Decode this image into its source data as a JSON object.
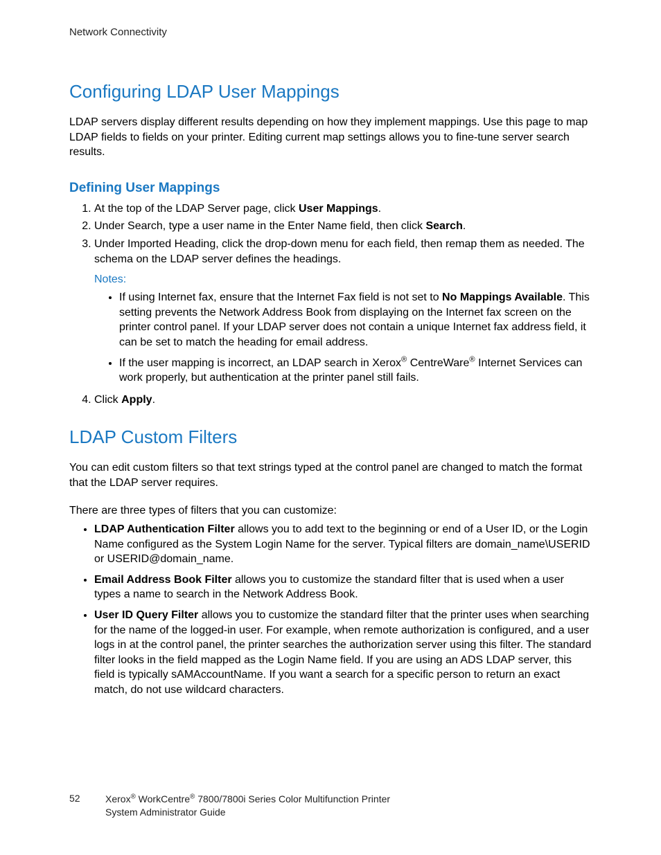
{
  "header": "Network Connectivity",
  "section1": {
    "title": "Configuring LDAP User Mappings",
    "intro": "LDAP servers display different results depending on how they implement mappings. Use this page to map LDAP fields to fields on your printer. Editing current map settings allows you to fine-tune server search results.",
    "sub": {
      "title": "Defining User Mappings",
      "step1a": "At the top of the LDAP Server page, click ",
      "step1b": "User Mappings",
      "step1c": ".",
      "step2a": "Under Search, type a user name in the Enter Name field, then click ",
      "step2b": "Search",
      "step2c": ".",
      "step3": "Under Imported Heading, click the drop-down menu for each field, then remap them as needed. The schema on the LDAP server defines the headings.",
      "notes_label": "Notes:",
      "note1a": "If using Internet fax, ensure that the Internet Fax field is not set to ",
      "note1b": "No Mappings Available",
      "note1c": ". This setting prevents the Network Address Book from displaying on the Internet fax screen on the printer control panel. If your LDAP server does not contain a unique Internet fax address field, it can be set to match the heading for email address.",
      "note2a": "If the user mapping is incorrect, an LDAP search in Xerox",
      "note2b": " CentreWare",
      "note2c": " Internet Services can work properly, but authentication at the printer panel still fails.",
      "step4a": "Click ",
      "step4b": "Apply",
      "step4c": "."
    }
  },
  "section2": {
    "title": "LDAP Custom Filters",
    "p1": "You can edit custom filters so that text strings typed at the control panel are changed to match the format that the LDAP server requires.",
    "p2": "There are three types of filters that you can customize:",
    "b1a": "LDAP Authentication Filter",
    "b1b": " allows you to add text to the beginning or end of a User ID, or the Login Name configured as the System Login Name for the server. Typical filters are domain_name\\USERID or USERID@domain_name.",
    "b2a": "Email Address Book Filter",
    "b2b": " allows you to customize the standard filter that is used when a user types a name to search in the Network Address Book.",
    "b3a": "User ID Query Filter",
    "b3b": " allows you to customize the standard filter that the printer uses when searching for the name of the logged-in user. For example, when remote authorization is configured, and a user logs in at the control panel, the printer searches the authorization server using this filter. The standard filter looks in the field mapped as the Login Name field. If you are using an ADS LDAP server, this field is typically sAMAccountName. If you want a search for a specific person to return an exact match, do not use wildcard characters."
  },
  "footer": {
    "page": "52",
    "line1a": "Xerox",
    "line1b": " WorkCentre",
    "line1c": " 7800/7800i Series Color Multifunction Printer",
    "line2": "System Administrator Guide"
  },
  "reg": "®"
}
